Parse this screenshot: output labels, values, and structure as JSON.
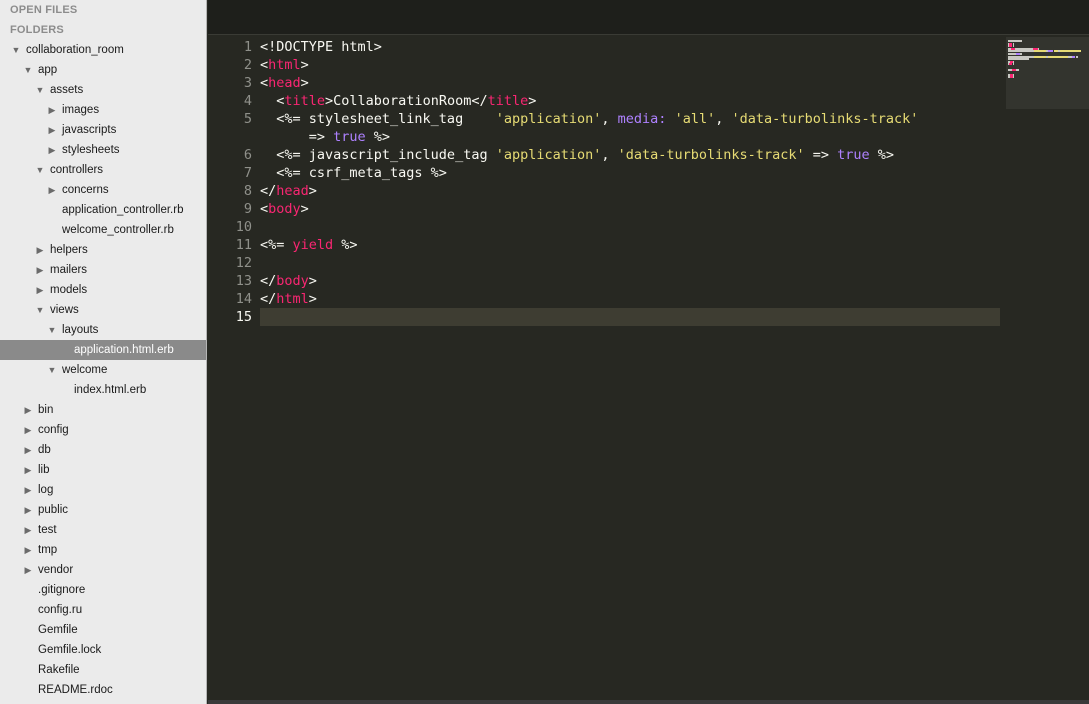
{
  "sidebar": {
    "open_files_header": "OPEN FILES",
    "folders_header": "FOLDERS",
    "tree": [
      {
        "label": "collaboration_room",
        "indent": 0,
        "disclosure": "expanded"
      },
      {
        "label": "app",
        "indent": 1,
        "disclosure": "expanded"
      },
      {
        "label": "assets",
        "indent": 2,
        "disclosure": "expanded"
      },
      {
        "label": "images",
        "indent": 3,
        "disclosure": "collapsed"
      },
      {
        "label": "javascripts",
        "indent": 3,
        "disclosure": "collapsed"
      },
      {
        "label": "stylesheets",
        "indent": 3,
        "disclosure": "collapsed"
      },
      {
        "label": "controllers",
        "indent": 2,
        "disclosure": "expanded"
      },
      {
        "label": "concerns",
        "indent": 3,
        "disclosure": "collapsed"
      },
      {
        "label": "application_controller.rb",
        "indent": 3,
        "disclosure": "none"
      },
      {
        "label": "welcome_controller.rb",
        "indent": 3,
        "disclosure": "none"
      },
      {
        "label": "helpers",
        "indent": 2,
        "disclosure": "collapsed"
      },
      {
        "label": "mailers",
        "indent": 2,
        "disclosure": "collapsed"
      },
      {
        "label": "models",
        "indent": 2,
        "disclosure": "collapsed"
      },
      {
        "label": "views",
        "indent": 2,
        "disclosure": "expanded"
      },
      {
        "label": "layouts",
        "indent": 3,
        "disclosure": "expanded"
      },
      {
        "label": "application.html.erb",
        "indent": 4,
        "disclosure": "none",
        "selected": true
      },
      {
        "label": "welcome",
        "indent": 3,
        "disclosure": "expanded"
      },
      {
        "label": "index.html.erb",
        "indent": 4,
        "disclosure": "none"
      },
      {
        "label": "bin",
        "indent": 1,
        "disclosure": "collapsed"
      },
      {
        "label": "config",
        "indent": 1,
        "disclosure": "collapsed"
      },
      {
        "label": "db",
        "indent": 1,
        "disclosure": "collapsed"
      },
      {
        "label": "lib",
        "indent": 1,
        "disclosure": "collapsed"
      },
      {
        "label": "log",
        "indent": 1,
        "disclosure": "collapsed"
      },
      {
        "label": "public",
        "indent": 1,
        "disclosure": "collapsed"
      },
      {
        "label": "test",
        "indent": 1,
        "disclosure": "collapsed"
      },
      {
        "label": "tmp",
        "indent": 1,
        "disclosure": "collapsed"
      },
      {
        "label": "vendor",
        "indent": 1,
        "disclosure": "collapsed"
      },
      {
        "label": ".gitignore",
        "indent": 1,
        "disclosure": "none"
      },
      {
        "label": "config.ru",
        "indent": 1,
        "disclosure": "none"
      },
      {
        "label": "Gemfile",
        "indent": 1,
        "disclosure": "none"
      },
      {
        "label": "Gemfile.lock",
        "indent": 1,
        "disclosure": "none"
      },
      {
        "label": "Rakefile",
        "indent": 1,
        "disclosure": "none"
      },
      {
        "label": "README.rdoc",
        "indent": 1,
        "disclosure": "none"
      }
    ]
  },
  "editor": {
    "current_line": "15",
    "line_numbers": [
      "1",
      "2",
      "3",
      "4",
      "5",
      "",
      "6",
      "7",
      "8",
      "9",
      "10",
      "11",
      "12",
      "13",
      "14",
      "15"
    ],
    "lines": [
      [
        {
          "t": "<!DOCTYPE html>",
          "c": ""
        }
      ],
      [
        {
          "t": "<",
          "c": ""
        },
        {
          "t": "html",
          "c": "tag"
        },
        {
          "t": ">",
          "c": ""
        }
      ],
      [
        {
          "t": "<",
          "c": ""
        },
        {
          "t": "head",
          "c": "tag"
        },
        {
          "t": ">",
          "c": ""
        }
      ],
      [
        {
          "t": "  <",
          "c": ""
        },
        {
          "t": "title",
          "c": "tag"
        },
        {
          "t": ">CollaborationRoom</",
          "c": ""
        },
        {
          "t": "title",
          "c": "tag"
        },
        {
          "t": ">",
          "c": ""
        }
      ],
      [
        {
          "t": "  <%= stylesheet_link_tag    ",
          "c": ""
        },
        {
          "t": "'application'",
          "c": "str"
        },
        {
          "t": ", ",
          "c": ""
        },
        {
          "t": "media:",
          "c": "sym"
        },
        {
          "t": " ",
          "c": ""
        },
        {
          "t": "'all'",
          "c": "str"
        },
        {
          "t": ", ",
          "c": ""
        },
        {
          "t": "'data-turbolinks-track'",
          "c": "str"
        }
      ],
      [
        {
          "t": "      => ",
          "c": ""
        },
        {
          "t": "true",
          "c": "const"
        },
        {
          "t": " %>",
          "c": ""
        }
      ],
      [
        {
          "t": "  <%= javascript_include_tag ",
          "c": ""
        },
        {
          "t": "'application'",
          "c": "str"
        },
        {
          "t": ", ",
          "c": ""
        },
        {
          "t": "'data-turbolinks-track'",
          "c": "str"
        },
        {
          "t": " => ",
          "c": ""
        },
        {
          "t": "true",
          "c": "const"
        },
        {
          "t": " %>",
          "c": ""
        }
      ],
      [
        {
          "t": "  <%= csrf_meta_tags %>",
          "c": ""
        }
      ],
      [
        {
          "t": "</",
          "c": ""
        },
        {
          "t": "head",
          "c": "tag"
        },
        {
          "t": ">",
          "c": ""
        }
      ],
      [
        {
          "t": "<",
          "c": ""
        },
        {
          "t": "body",
          "c": "tag"
        },
        {
          "t": ">",
          "c": ""
        }
      ],
      [],
      [
        {
          "t": "<%= ",
          "c": ""
        },
        {
          "t": "yield",
          "c": "tag"
        },
        {
          "t": " %>",
          "c": ""
        }
      ],
      [],
      [
        {
          "t": "</",
          "c": ""
        },
        {
          "t": "body",
          "c": "tag"
        },
        {
          "t": ">",
          "c": ""
        }
      ],
      [
        {
          "t": "</",
          "c": ""
        },
        {
          "t": "html",
          "c": "tag"
        },
        {
          "t": ">",
          "c": ""
        }
      ],
      []
    ]
  },
  "colors": {
    "editor_bg": "#272822",
    "tag": "#f92672",
    "string": "#e6db74",
    "constant": "#ae81ff",
    "text": "#f8f8f2",
    "sidebar_bg": "#ebebeb",
    "selected_row": "#8a8a8a"
  }
}
